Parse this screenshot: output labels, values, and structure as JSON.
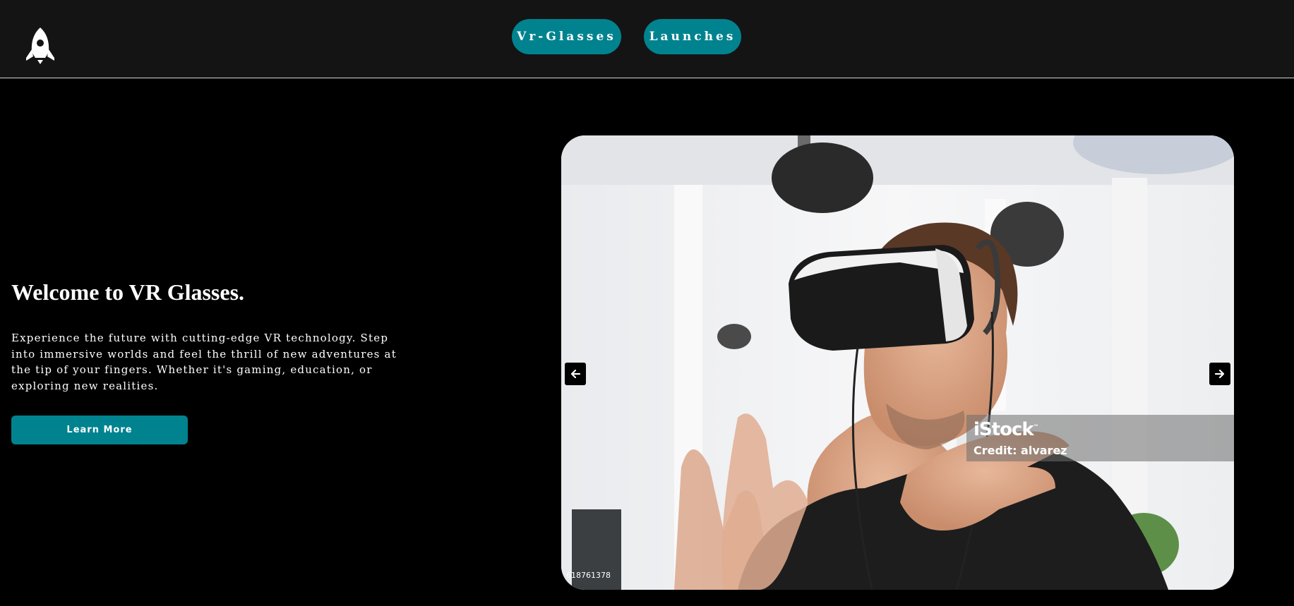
{
  "nav": {
    "logo_icon": "rocket-icon",
    "items": [
      {
        "label": "Vr-Glasses"
      },
      {
        "label": "Launches"
      }
    ]
  },
  "hero": {
    "title": "Welcome to VR Glasses.",
    "description": "Experience the future with cutting-edge VR technology. Step into immersive worlds and feel the thrill of new adventures at the tip of your fingers. Whether it's gaming, education, or exploring new realities.",
    "cta_label": "Learn More"
  },
  "carousel": {
    "prev_icon": "arrow-left-icon",
    "next_icon": "arrow-right-icon",
    "watermark_brand": "iStock",
    "watermark_tm": "™",
    "watermark_credit": "Credit: alvarez",
    "photo_id": "618761378"
  },
  "colors": {
    "accent": "#00838f",
    "navbar_bg": "#141414",
    "page_bg": "#000000",
    "text": "#ffffff"
  }
}
